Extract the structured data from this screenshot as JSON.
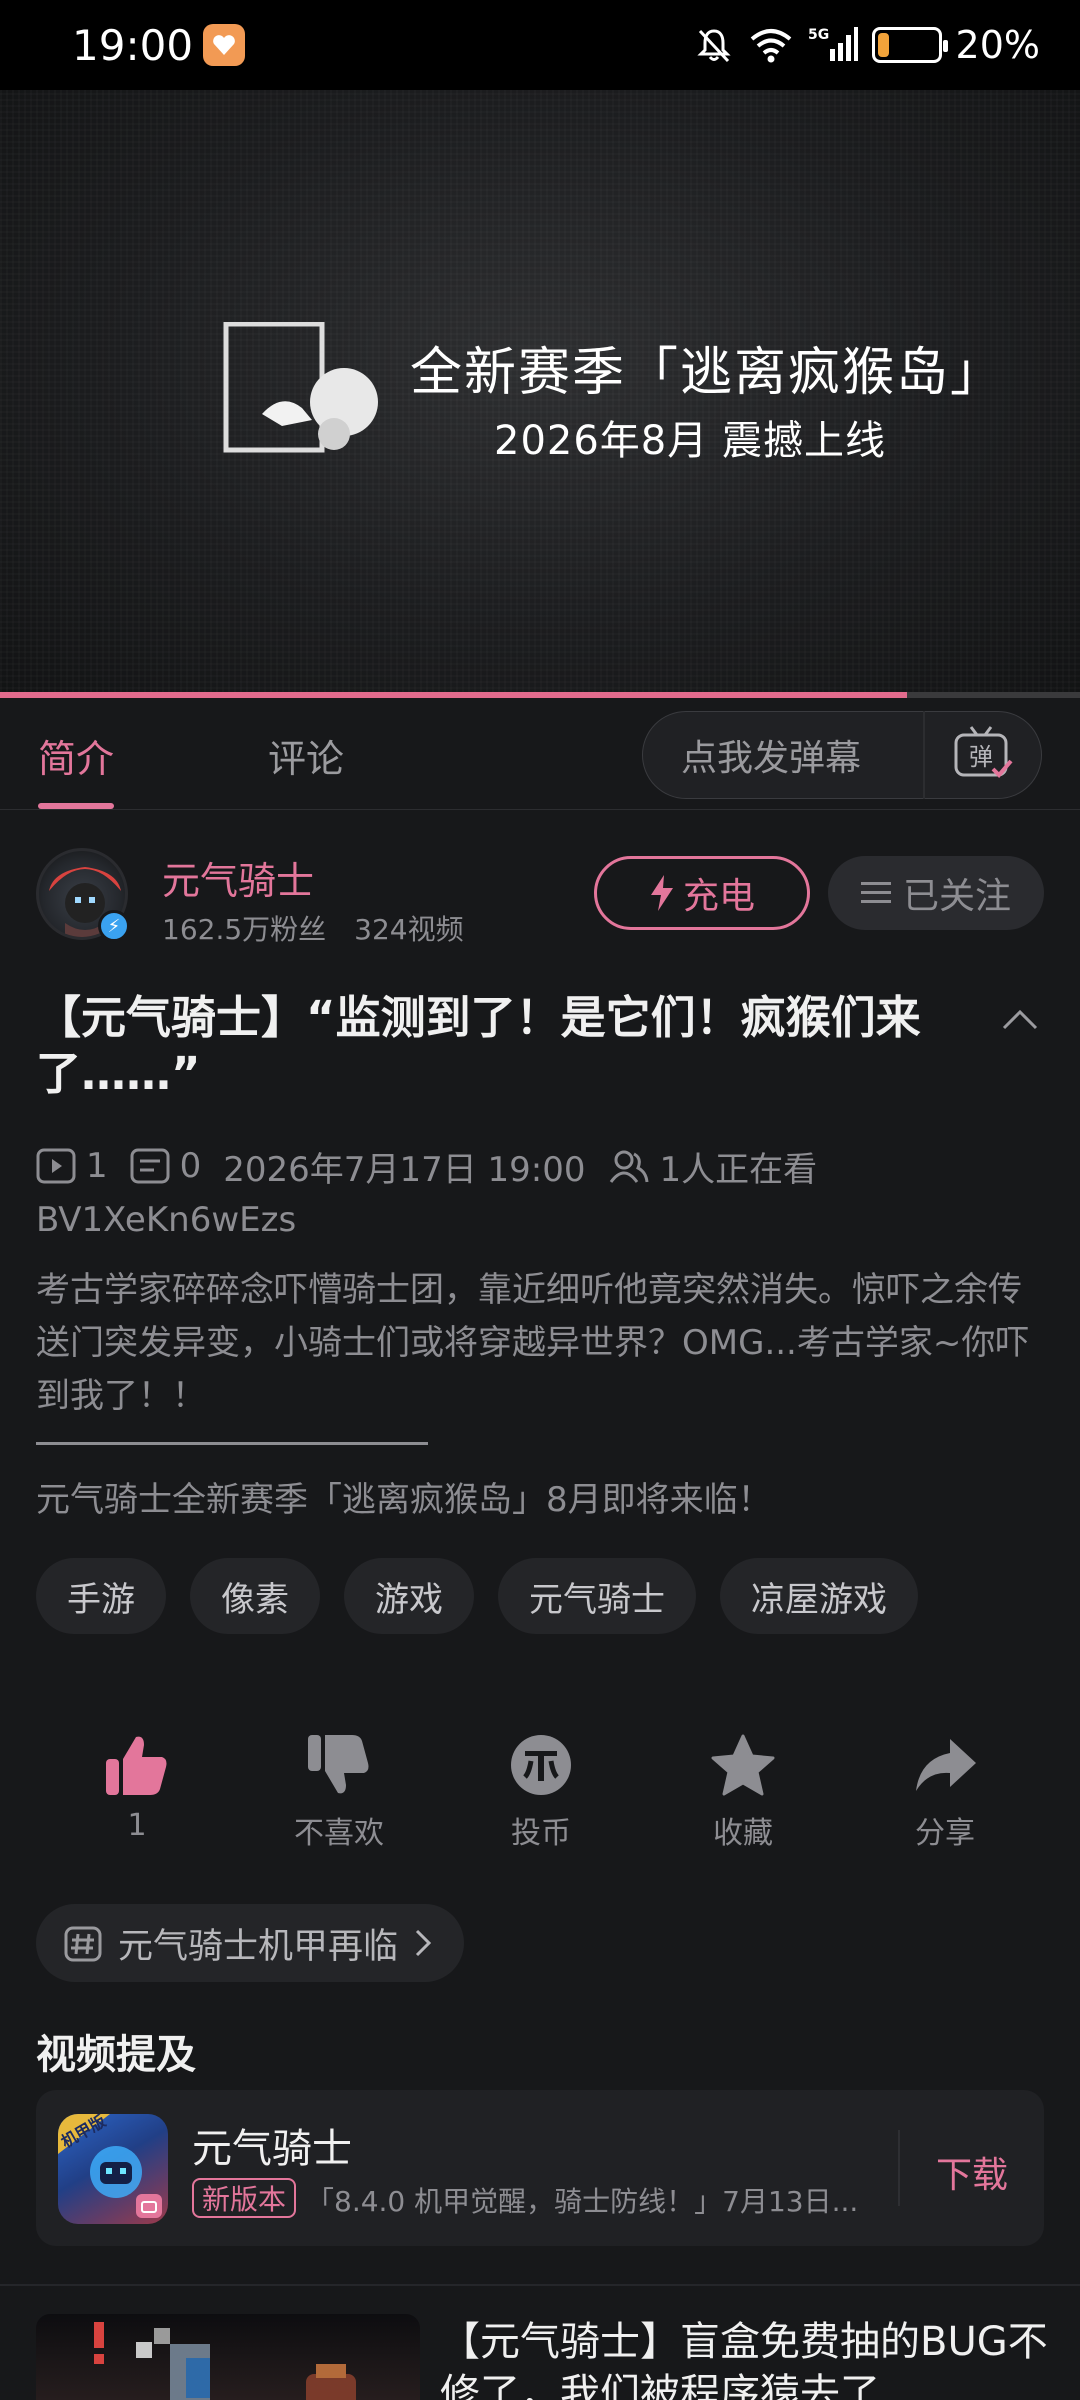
{
  "status_bar": {
    "time": "19:00",
    "battery": "20%",
    "battery_level": 0.2
  },
  "player": {
    "title": "全新赛季「逃离疯猴岛」",
    "subtitle": "2026年8月 震撼上线",
    "progress": 0.84
  },
  "tabs": {
    "intro": "简介",
    "comments": "评论",
    "danmaku_placeholder": "点我发弹幕",
    "danmaku_toggle": "弹"
  },
  "author": {
    "name": "元气骑士",
    "fans": "162.5万粉丝",
    "videos": "324视频",
    "charge_label": "充电",
    "follow_label": "已关注"
  },
  "video": {
    "title": "【元气骑士】“监测到了！是它们！疯猴们来了……”",
    "plays": "1",
    "danmaku_count": "0",
    "publish_time": "2026年7月17日 19:00",
    "watching": "1人正在看",
    "bvid": "BV1XeKn6wEzs",
    "description": "考古学家碎碎念吓懵骑士团，靠近细听他竟突然消失。惊吓之余传送门突发异变，小骑士们或将穿越异世界？OMG...考古学家~你吓到我了！！",
    "description_extra": "元气骑士全新赛季「逃离疯猴岛」8月即将来临！"
  },
  "tags": [
    "手游",
    "像素",
    "游戏",
    "元气骑士",
    "凉屋游戏"
  ],
  "actions": {
    "like": "1",
    "dislike": "不喜欢",
    "coin": "投币",
    "favorite": "收藏",
    "share": "分享"
  },
  "topic": {
    "label": "元气骑士机甲再临"
  },
  "mentions": {
    "section_title": "视频提及",
    "game_name": "元气骑士",
    "version_badge": "新版本",
    "version_note": "「8.4.0 机甲觉醒，骑士防线！」7月13日...",
    "download_label": "下载",
    "icon_text": "机甲版"
  },
  "next_video": {
    "title": "【元气骑士】盲盒免费抽的BUG不修了，我们被程序猿去了"
  },
  "colors": {
    "accent": "#e3769b",
    "background": "#17181a",
    "muted_text": "#8d8d92"
  }
}
